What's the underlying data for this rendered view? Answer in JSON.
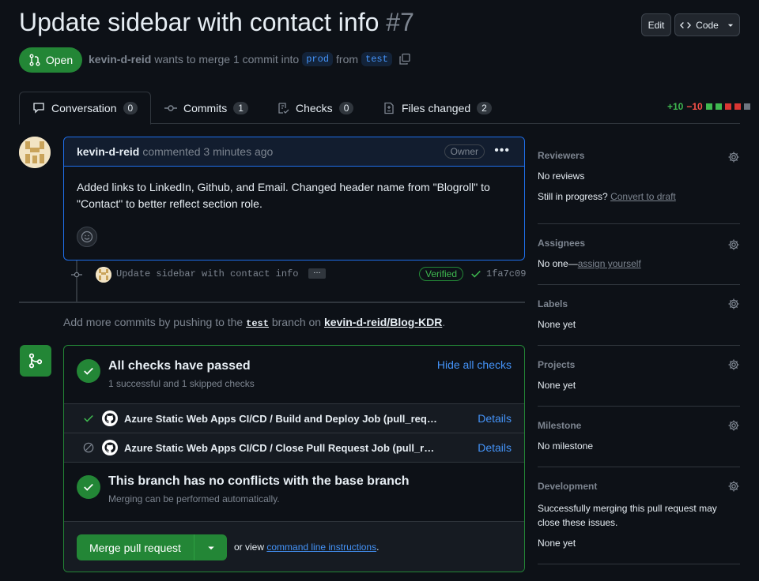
{
  "header": {
    "title": "Update sidebar with contact info",
    "number": "#7",
    "edit_label": "Edit",
    "code_label": "Code"
  },
  "state": {
    "label": "Open",
    "author": "kevin-d-reid",
    "text_a": "wants to merge 1 commit into",
    "base": "prod",
    "text_b": "from",
    "head": "test"
  },
  "tabs": [
    {
      "label": "Conversation",
      "count": "0"
    },
    {
      "label": "Commits",
      "count": "1"
    },
    {
      "label": "Checks",
      "count": "0"
    },
    {
      "label": "Files changed",
      "count": "2"
    }
  ],
  "diffstat": {
    "added": "+10",
    "removed": "−10"
  },
  "comment": {
    "author": "kevin-d-reid",
    "action": "commented 3 minutes ago",
    "badge": "Owner",
    "body": "Added links to LinkedIn, Github, and Email. Changed header name from \"Blogroll\" to \"Contact\" to better reflect section role."
  },
  "commit": {
    "message": "Update sidebar with contact info",
    "verified": "Verified",
    "sha": "1fa7c09"
  },
  "push_note": {
    "text_a": "Add more commits by pushing to the",
    "branch": "test",
    "text_b": "branch on",
    "repo": "kevin-d-reid/Blog-KDR",
    "end": "."
  },
  "checks": {
    "title": "All checks have passed",
    "subtitle": "1 successful and 1 skipped checks",
    "hide_label": "Hide all checks",
    "items": [
      {
        "name": "Azure Static Web Apps CI/CD / Build and Deploy Job (pull_request)",
        "details": "Details",
        "status": "success"
      },
      {
        "name": "Azure Static Web Apps CI/CD / Close Pull Request Job (pull_request)",
        "details": "Details",
        "status": "skipped"
      }
    ]
  },
  "conflicts": {
    "title": "This branch has no conflicts with the base branch",
    "subtitle": "Merging can be performed automatically."
  },
  "merge": {
    "button": "Merge pull request",
    "or_view": "or view",
    "cli_link": "command line instructions",
    "end": "."
  },
  "sidebar": {
    "reviewers": {
      "title": "Reviewers",
      "line1": "No reviews",
      "line2": "Still in progress?",
      "link": "Convert to draft"
    },
    "assignees": {
      "title": "Assignees",
      "text": "No one—",
      "link": "assign yourself"
    },
    "labels": {
      "title": "Labels",
      "text": "None yet"
    },
    "projects": {
      "title": "Projects",
      "text": "None yet"
    },
    "milestone": {
      "title": "Milestone",
      "text": "No milestone"
    },
    "development": {
      "title": "Development",
      "text": "Successfully merging this pull request may close these issues.",
      "text2": "None yet"
    }
  },
  "colors": {
    "accent": "#238636",
    "link": "#4493f8",
    "bg": "#0d1117"
  }
}
